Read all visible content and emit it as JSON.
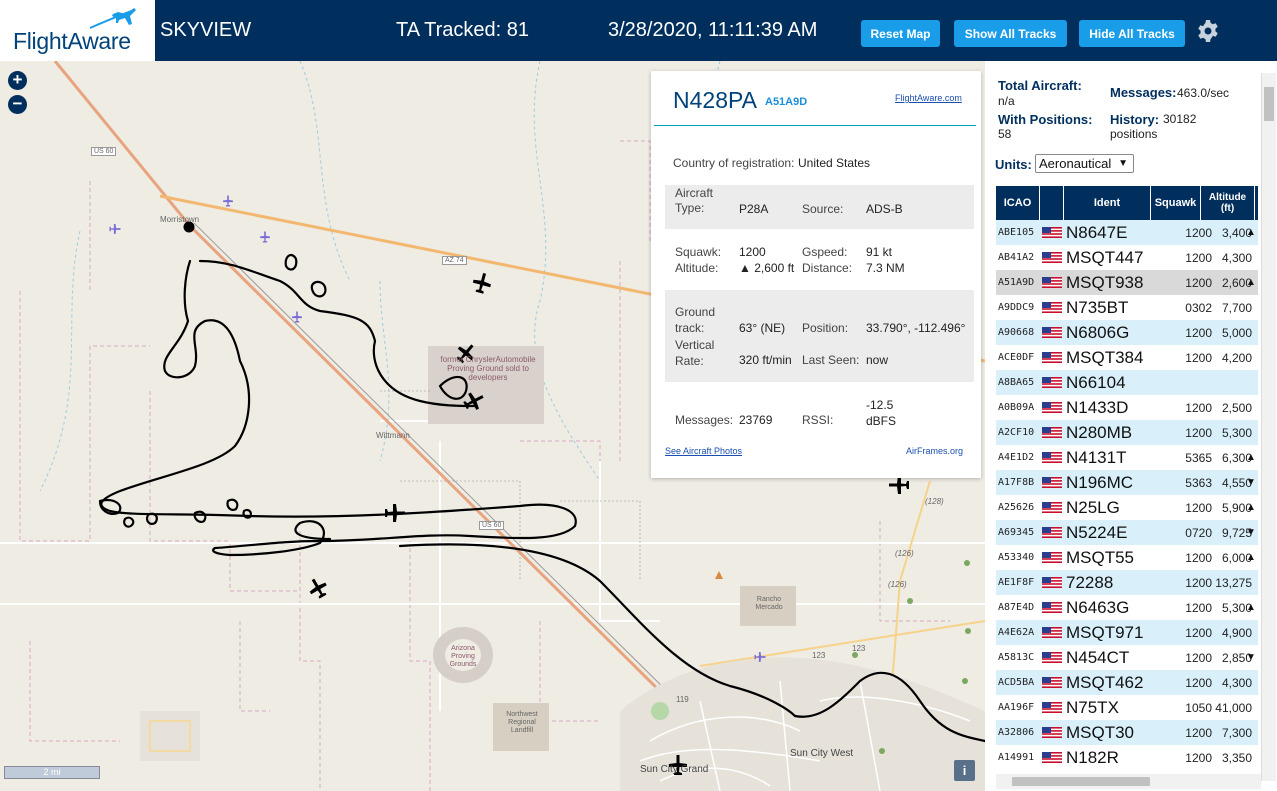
{
  "header": {
    "logo_text": "FlightAware",
    "app_name": "SKYVIEW",
    "tracked": "TA Tracked: 81",
    "datetime": "3/28/2020, 11:11:39 AM",
    "buttons": {
      "reset": "Reset Map",
      "show": "Show All Tracks",
      "hide": "Hide All Tracks"
    },
    "colors": {
      "bar": "#002f5d",
      "button": "#1a9de8"
    }
  },
  "map": {
    "zoom_in": "+",
    "zoom_out": "−",
    "scale": "2 mi",
    "info": "i",
    "labels": {
      "us60_a": "US 60",
      "us60_b": "US 60",
      "az74": "AZ 74",
      "morristown": "Morristown",
      "wittmann": "Wittmann",
      "proving": "former ChryslerAutomobile Proving Ground sold to developers",
      "arizona_proving": "Arizona Proving Grounds",
      "rancho": "Rancho Mercado",
      "landfill": "Northwest Regional Landfill",
      "sun_city_west": "Sun City West",
      "sun_city_grand": "Sun City Grand",
      "r126a": "(126)",
      "r126b": "(126)",
      "r128": "(128)",
      "r123a": "123",
      "r123b": "123",
      "r119": "119"
    }
  },
  "popup": {
    "registration": "N428PA",
    "hex": "A51A9D",
    "fa_link": "FlightAware.com",
    "country_label": "Country of registration:",
    "country": "United States",
    "aircraft_label": "Aircraft Type:",
    "aircraft_type": "P28A",
    "source_label": "Source:",
    "source": "ADS-B",
    "squawk_label": "Squawk:",
    "squawk": "1200",
    "gspeed_label": "Gspeed:",
    "gspeed": "91 kt",
    "altitude_label": "Altitude:",
    "altitude": "▲ 2,600 ft",
    "distance_label": "Distance:",
    "distance": "7.3 NM",
    "track_label": "Ground track:",
    "track": "63° (NE)",
    "position_label": "Position:",
    "position": "33.790°, -112.496°",
    "vrate_label": "Vertical Rate:",
    "vrate": "320 ft/min",
    "lastseen_label": "Last Seen:",
    "lastseen": "now",
    "messages_label": "Messages:",
    "messages": "23769",
    "rssi_label": "RSSI:",
    "rssi": "-12.5 dBFS",
    "photos_link": "See Aircraft Photos",
    "airframes_link": "AirFrames.org"
  },
  "stats": {
    "total_label": "Total Aircraft:",
    "total": "n/a",
    "messages_label": "Messages:",
    "messages": "463.0/sec",
    "withpos_label": "With Positions:",
    "withpos": "58",
    "history_label": "History:",
    "history": "30182 positions"
  },
  "units": {
    "label": "Units:",
    "selected": "Aeronautical"
  },
  "table": {
    "headers": {
      "icao": "ICAO",
      "ident": "Ident",
      "squawk": "Squawk",
      "altitude": "Altitude (ft)"
    },
    "rows": [
      {
        "icao": "ABE105",
        "ident": "N8647E",
        "squawk": "1200",
        "alt": "3,400",
        "arrow": "▲"
      },
      {
        "icao": "AB41A2",
        "ident": "MSQT447",
        "squawk": "1200",
        "alt": "4,300",
        "arrow": ""
      },
      {
        "icao": "A51A9D",
        "ident": "MSQT938",
        "squawk": "1200",
        "alt": "2,600",
        "arrow": "▲",
        "selected": true
      },
      {
        "icao": "A9DDC9",
        "ident": "N735BT",
        "squawk": "0302",
        "alt": "7,700",
        "arrow": ""
      },
      {
        "icao": "A90668",
        "ident": "N6806G",
        "squawk": "1200",
        "alt": "5,000",
        "arrow": ""
      },
      {
        "icao": "ACE0DF",
        "ident": "MSQT384",
        "squawk": "1200",
        "alt": "4,200",
        "arrow": ""
      },
      {
        "icao": "A8BA65",
        "ident": "N66104",
        "squawk": "",
        "alt": "",
        "arrow": ""
      },
      {
        "icao": "A0B09A",
        "ident": "N1433D",
        "squawk": "1200",
        "alt": "2,500",
        "arrow": ""
      },
      {
        "icao": "A2CF10",
        "ident": "N280MB",
        "squawk": "1200",
        "alt": "5,300",
        "arrow": ""
      },
      {
        "icao": "A4E1D2",
        "ident": "N4131T",
        "squawk": "5365",
        "alt": "6,300",
        "arrow": "▲"
      },
      {
        "icao": "A17F8B",
        "ident": "N196MC",
        "squawk": "5363",
        "alt": "4,550",
        "arrow": "▼"
      },
      {
        "icao": "A25626",
        "ident": "N25LG",
        "squawk": "1200",
        "alt": "5,900",
        "arrow": "▲"
      },
      {
        "icao": "A69345",
        "ident": "N5224E",
        "squawk": "0720",
        "alt": "9,725",
        "arrow": "▼"
      },
      {
        "icao": "A53340",
        "ident": "MSQT55",
        "squawk": "1200",
        "alt": "6,000",
        "arrow": "▲"
      },
      {
        "icao": "AE1F8F",
        "ident": "72288",
        "squawk": "1200",
        "alt": "13,275",
        "arrow": ""
      },
      {
        "icao": "A87E4D",
        "ident": "N6463G",
        "squawk": "1200",
        "alt": "5,300",
        "arrow": "▲"
      },
      {
        "icao": "A4E62A",
        "ident": "MSQT971",
        "squawk": "1200",
        "alt": "4,900",
        "arrow": ""
      },
      {
        "icao": "A5813C",
        "ident": "N454CT",
        "squawk": "1200",
        "alt": "2,850",
        "arrow": "▼"
      },
      {
        "icao": "ACD5BA",
        "ident": "MSQT462",
        "squawk": "1200",
        "alt": "4,300",
        "arrow": ""
      },
      {
        "icao": "AA196F",
        "ident": "N75TX",
        "squawk": "1050",
        "alt": "41,000",
        "arrow": ""
      },
      {
        "icao": "A32806",
        "ident": "MSQT30",
        "squawk": "1200",
        "alt": "7,300",
        "arrow": ""
      },
      {
        "icao": "A14991",
        "ident": "N182R",
        "squawk": "1200",
        "alt": "3,350",
        "arrow": ""
      }
    ],
    "row_colors": {
      "even": "#d9f0fb",
      "odd": "#ffffff",
      "selected": "#d9d9d9"
    }
  }
}
